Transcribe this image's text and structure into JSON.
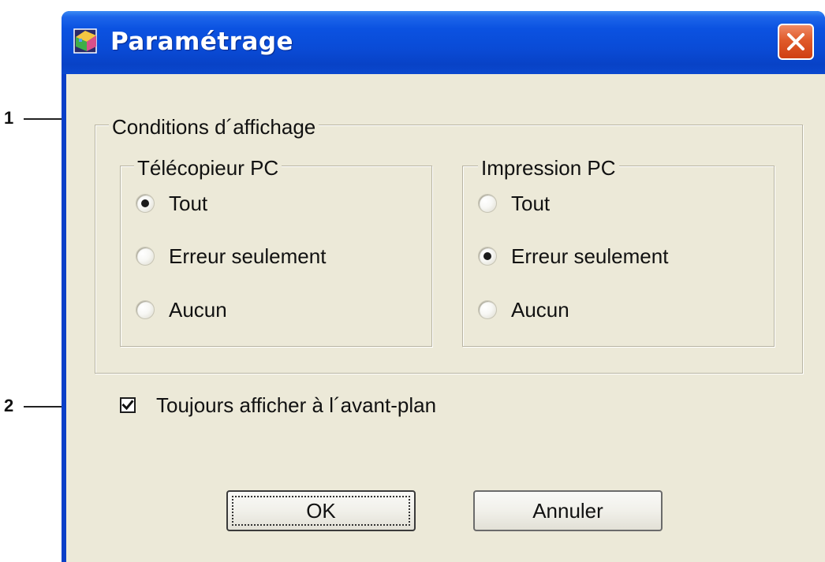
{
  "window": {
    "title": "Paramétrage"
  },
  "callouts": [
    "1",
    "2"
  ],
  "display_conditions": {
    "label": "Conditions d´affichage",
    "fax_group": {
      "label": "Télécopieur PC",
      "options": [
        "Tout",
        "Erreur seulement",
        "Aucun"
      ],
      "selected": "Tout"
    },
    "print_group": {
      "label": "Impression PC",
      "options": [
        "Tout",
        "Erreur seulement",
        "Aucun"
      ],
      "selected": "Erreur seulement"
    }
  },
  "always_on_top": {
    "label": "Toujours afficher à l´avant-plan",
    "checked": true
  },
  "buttons": {
    "ok_label": "OK",
    "cancel_label": "Annuler"
  },
  "colors": {
    "titlebar_blue": "#0a4bd6",
    "dialog_background": "#ece9d8",
    "close_button_red": "#e05a2a"
  },
  "icons": {
    "app": "app-icon",
    "close": "close-icon",
    "check": "checkmark-icon"
  }
}
